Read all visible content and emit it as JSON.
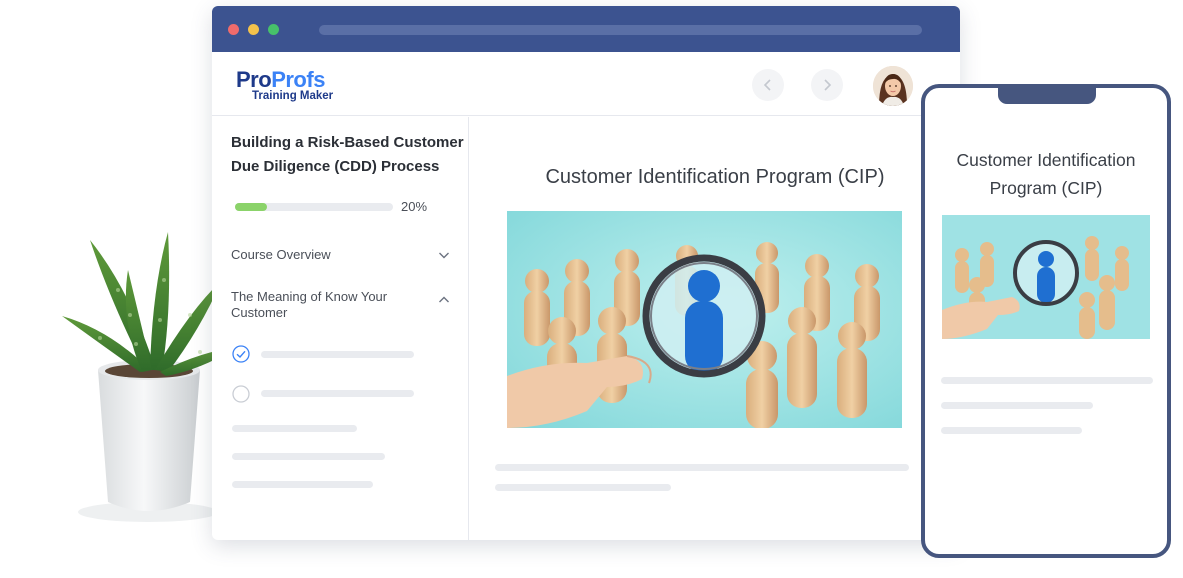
{
  "browser": {
    "window_dots": [
      "#ef6b6b",
      "#f4c24b",
      "#47c16a"
    ]
  },
  "app": {
    "logo_pro": "Pro",
    "logo_profs": "Profs",
    "logo_sub": "Training Maker"
  },
  "sidebar": {
    "course_title": "Building a Risk-Based Customer Due Diligence (CDD) Process",
    "progress_text": "20%",
    "progress_value": 0.2,
    "sections": [
      {
        "label": "Course Overview",
        "expanded": false
      },
      {
        "label": "The Meaning of Know Your Customer",
        "expanded": true
      }
    ]
  },
  "content": {
    "title": "Customer Identification Program (CIP)"
  },
  "phone": {
    "title": "Customer Identification Program (CIP)"
  },
  "colors": {
    "titlebar": "#3c5390",
    "progress": "#8bd36a",
    "phone_frame": "#46567f",
    "check_accent": "#3b82f6"
  }
}
